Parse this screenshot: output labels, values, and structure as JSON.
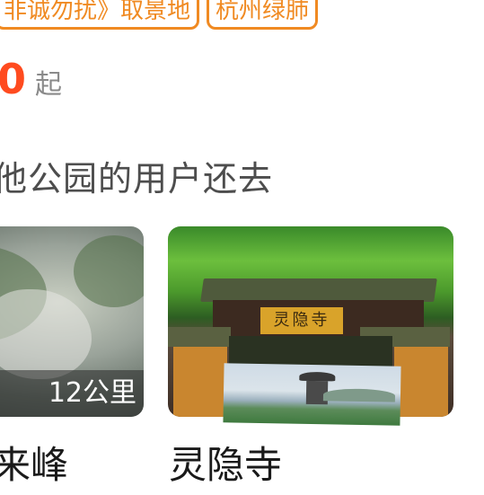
{
  "tags": [
    {
      "label": "非诚勿扰》取景地"
    },
    {
      "label": "杭州绿肺"
    }
  ],
  "price": {
    "value": "0",
    "suffix": "起"
  },
  "section": {
    "title": "他公园的用户还去"
  },
  "cards": [
    {
      "title": "来峰",
      "distance": "12公里"
    },
    {
      "title": "灵隐寺",
      "plaque": "灵隐寺"
    }
  ],
  "colors": {
    "accent_orange": "#f08a22",
    "price_red": "#ff4b1f",
    "text_dark": "#1a1a1a",
    "text_gray": "#8a8a8a"
  },
  "icons": [
    "photo-thumbnail"
  ]
}
